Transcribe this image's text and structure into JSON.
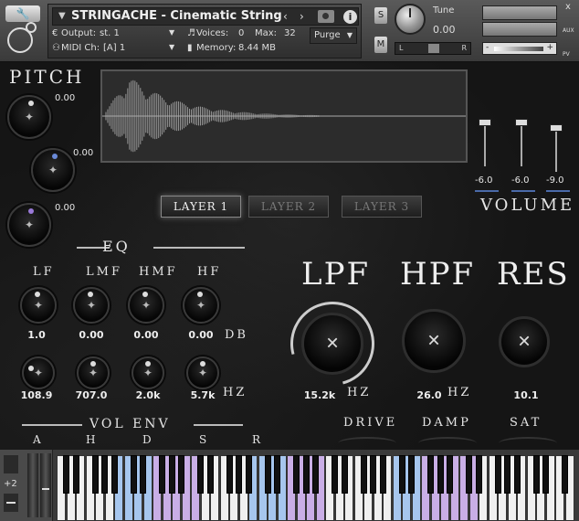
{
  "header": {
    "title": "STRINGACHE - Cinematic String SFX",
    "output_label": "Output:",
    "output_value": "st. 1",
    "voices_label": "Voices:",
    "voices_value": "0",
    "max_label": "Max:",
    "max_value": "32",
    "purge_label": "Purge",
    "midi_label": "MIDI Ch:",
    "midi_value": "[A]  1",
    "memory_label": "Memory:",
    "memory_value": "8.44 MB",
    "s_label": "S",
    "m_label": "M",
    "tune_label": "Tune",
    "tune_value": "0.00",
    "pan_left": "L",
    "pan_right": "R",
    "vol_minus": "-",
    "vol_plus": "+",
    "close": "x",
    "aux_label": "AUX",
    "pv_label": "PV"
  },
  "pitch": {
    "title": "PITCH",
    "values": [
      "0.00",
      "0.00",
      "0.00"
    ]
  },
  "layers": [
    "LAYER 1",
    "LAYER 2",
    "LAYER 3"
  ],
  "active_layer": 0,
  "volume": {
    "title": "VOLUME",
    "values": [
      "-6.0",
      "-6.0",
      "-9.0"
    ]
  },
  "eq": {
    "title": "EQ",
    "bands": [
      "LF",
      "LMF",
      "HMF",
      "HF"
    ],
    "gains": [
      "1.0",
      "0.00",
      "0.00",
      "0.00"
    ],
    "gain_unit": "DB",
    "freqs": [
      "108.9",
      "707.0",
      "2.0k",
      "5.7k"
    ],
    "freq_unit": "HZ"
  },
  "filters": {
    "lpf_label": "LPF",
    "hpf_label": "HPF",
    "res_label": "RES",
    "lpf_value": "15.2k",
    "lpf_unit": "HZ",
    "hpf_value": "26.0",
    "hpf_unit": "HZ",
    "res_value": "10.1"
  },
  "envelope": {
    "title": "VOL ENV",
    "labels": [
      "A",
      "H",
      "D",
      "S",
      "R"
    ]
  },
  "fx": {
    "labels": [
      "DRIVE",
      "DAMP",
      "SAT"
    ]
  },
  "keyboard": {
    "octave_label": "+2",
    "key_colors": {
      "blue": "#a6c6ee",
      "purple": "#c9aee6",
      "white": "#f0f0f0"
    }
  }
}
